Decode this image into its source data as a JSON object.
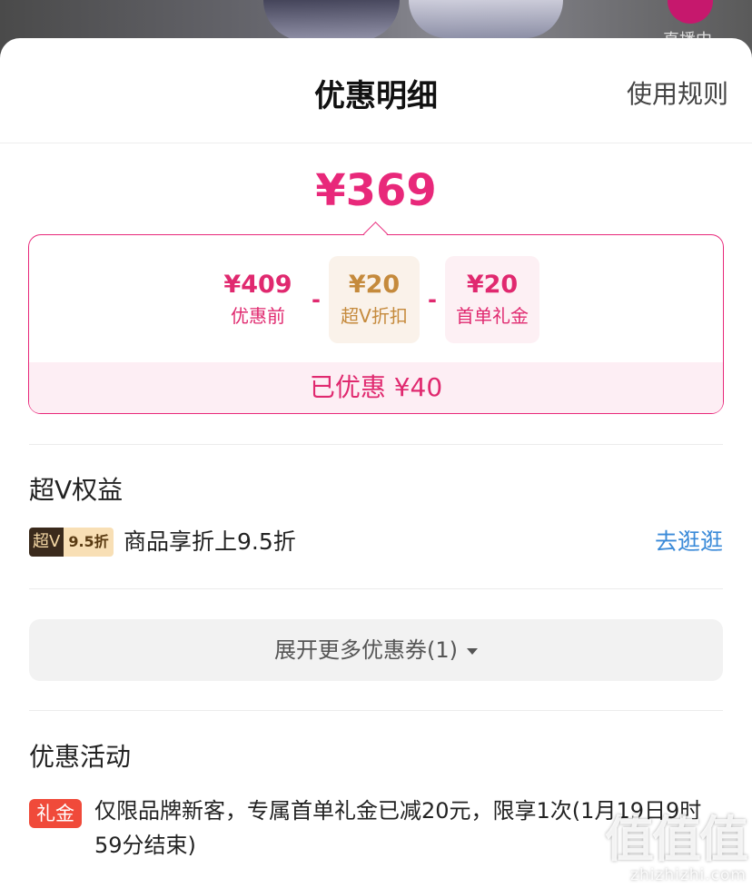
{
  "background": {
    "live_label": "直播中"
  },
  "header": {
    "title": "优惠明细",
    "rules_link": "使用规则"
  },
  "price": {
    "final": "¥369",
    "items": [
      {
        "amount": "¥409",
        "label": "优惠前"
      },
      {
        "amount": "¥20",
        "label": "超V折扣"
      },
      {
        "amount": "¥20",
        "label": "首单礼金"
      }
    ],
    "minus_sign": "-",
    "saved": "已优惠 ¥40"
  },
  "super_v": {
    "section_title": "超V权益",
    "tag_prefix": "超V",
    "tag_value": "9.5折",
    "description": "商品享折上9.5折",
    "link": "去逛逛"
  },
  "more_coupons": {
    "label": "展开更多优惠券(1)"
  },
  "activities": {
    "section_title": "优惠活动",
    "items": [
      {
        "tag": "礼金",
        "text": "仅限品牌新客，专属首单礼金已减20元，限享1次(1月19日9时59分结束)"
      }
    ]
  },
  "watermark": {
    "mark": "值值值",
    "site": "zhizhizhi.com"
  },
  "colors": {
    "accent": "#e8287a",
    "superv_gold": "#c58a3c",
    "link": "#3a8ad8",
    "activity_tag": "#f04a3a"
  }
}
